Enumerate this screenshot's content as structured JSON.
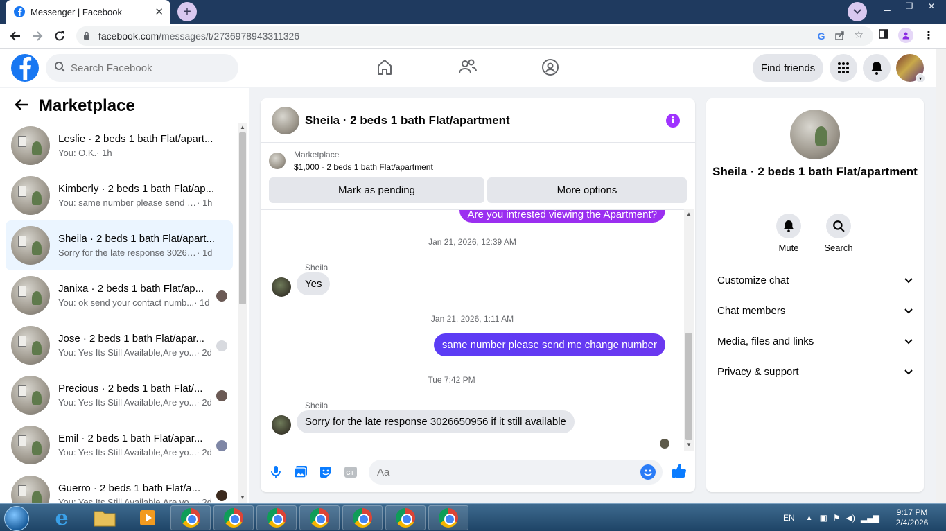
{
  "browser": {
    "tab_title": "Messenger | Facebook",
    "url_host": "facebook.com",
    "url_path": "/messages/t/2736978943311326"
  },
  "fb": {
    "search_placeholder": "Search Facebook",
    "find_friends": "Find friends"
  },
  "left": {
    "title": "Marketplace",
    "conversations": [
      {
        "name": "Leslie · 2 beds 1 bath Flat/apart...",
        "msg": "You: O.K.",
        "time": " · 1h"
      },
      {
        "name": "Kimberly · 2 beds 1 bath Flat/ap...",
        "msg": "You: same number please send me...",
        "time": " · 1h"
      },
      {
        "name": "Sheila · 2 beds 1 bath Flat/apart...",
        "msg": "Sorry for the late response 302665...",
        "time": " · 1d"
      },
      {
        "name": "Janixa · 2 beds 1 bath Flat/ap...",
        "msg": "You: ok send your contact numb...",
        "time": " · 1d"
      },
      {
        "name": "Jose · 2 beds 1 bath Flat/apar...",
        "msg": "You: Yes Its Still Available,Are yo...",
        "time": " · 2d"
      },
      {
        "name": "Precious · 2 beds 1 bath Flat/...",
        "msg": "You: Yes Its Still Available,Are yo...",
        "time": " · 2d"
      },
      {
        "name": "Emil · 2 beds 1 bath Flat/apar...",
        "msg": "You: Yes Its Still Available,Are yo...",
        "time": " · 2d"
      },
      {
        "name": "Guerro · 2 beds 1 bath Flat/a...",
        "msg": "You: Yes Its Still Available,Are yo...",
        "time": " · 2d"
      }
    ]
  },
  "chat": {
    "header_name": "Sheila · 2 beds 1 bath Flat/apartment",
    "marketplace_label": "Marketplace",
    "listing": "$1,000 - 2 beds 1 bath Flat/apartment",
    "mark_pending": "Mark as pending",
    "more_options": "More options",
    "partial_msg": "Are you intrested viewing the Apartment?",
    "ts1": "Jan 21, 2026, 12:39 AM",
    "sender1": "Sheila",
    "msg_in1": "Yes",
    "ts2": "Jan 21, 2026, 1:11 AM",
    "msg_out": "same number please send me change number",
    "ts3": "Tue 7:42 PM",
    "sender2": "Sheila",
    "msg_in2": "Sorry for the late response 3026650956 if it still available",
    "input_placeholder": "Aa"
  },
  "right": {
    "name": "Sheila · 2 beds 1 bath Flat/apartment",
    "mute": "Mute",
    "search": "Search",
    "items": [
      "Customize chat",
      "Chat members",
      "Media, files and links",
      "Privacy & support"
    ]
  },
  "taskbar": {
    "lang": "EN",
    "time": "9:17 PM",
    "date": "2/4/2026"
  },
  "colors": {
    "fb_blue": "#1877f2",
    "messenger_purple": "#6b38f0",
    "active_row": "#ebf5ff"
  }
}
